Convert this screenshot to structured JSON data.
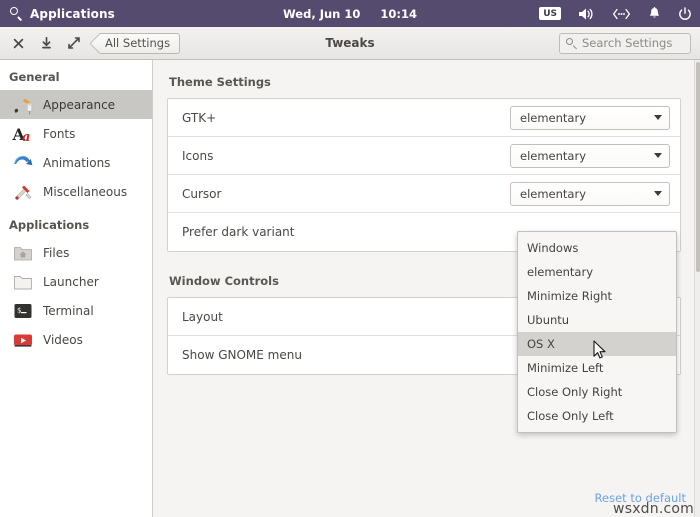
{
  "top_panel": {
    "search_icon": "search-icon",
    "applications_label": "Applications",
    "clock_day": "Wed, Jun 10",
    "clock_time": "10:14",
    "keyboard_layout": "us",
    "icons": [
      "volume-icon",
      "network-icon",
      "notifications-bell-icon",
      "power-icon"
    ],
    "background_color": "#554B6E"
  },
  "headerbar": {
    "close_label": "close-icon",
    "minimize_label": "minimize-icon",
    "maximize_label": "maximize-icon",
    "back_label": "All Settings",
    "title": "Tweaks",
    "search_placeholder": "Search Settings"
  },
  "sidebar": {
    "groups": [
      {
        "title": "General",
        "items": [
          {
            "label": "Appearance",
            "icon": "paintbrush-icon",
            "selected": true
          },
          {
            "label": "Fonts",
            "icon": "font-aa-icon",
            "selected": false
          },
          {
            "label": "Animations",
            "icon": "curved-arrow-icon",
            "selected": false
          },
          {
            "label": "Miscellaneous",
            "icon": "swiss-knife-icon",
            "selected": false
          }
        ]
      },
      {
        "title": "Applications",
        "items": [
          {
            "label": "Files",
            "icon": "folder-home-icon",
            "selected": false
          },
          {
            "label": "Launcher",
            "icon": "folder-icon",
            "selected": false
          },
          {
            "label": "Terminal",
            "icon": "terminal-icon",
            "selected": false
          },
          {
            "label": "Videos",
            "icon": "video-play-icon",
            "selected": false
          }
        ]
      }
    ]
  },
  "content": {
    "sections": [
      {
        "title": "Theme Settings",
        "rows": [
          {
            "label": "GTK+",
            "control": "combobox",
            "value": "elementary"
          },
          {
            "label": "Icons",
            "control": "combobox",
            "value": "elementary"
          },
          {
            "label": "Cursor",
            "control": "combobox",
            "value": "elementary"
          },
          {
            "label": "Prefer dark variant",
            "control": "switch",
            "value": ""
          }
        ]
      },
      {
        "title": "Window Controls",
        "rows": [
          {
            "label": "Layout",
            "control": "combobox",
            "value": ""
          },
          {
            "label": "Show GNOME menu",
            "control": "switch",
            "value": ""
          }
        ]
      }
    ],
    "reset_link": "Reset to default",
    "watermark": "wsxdn.com"
  },
  "dropdown": {
    "open_for_row": "Layout",
    "selected": "OS X",
    "items": [
      "Windows",
      "elementary",
      "Minimize Right",
      "Ubuntu",
      "OS X",
      "Minimize Left",
      "Close Only Right",
      "Close Only Left"
    ]
  }
}
